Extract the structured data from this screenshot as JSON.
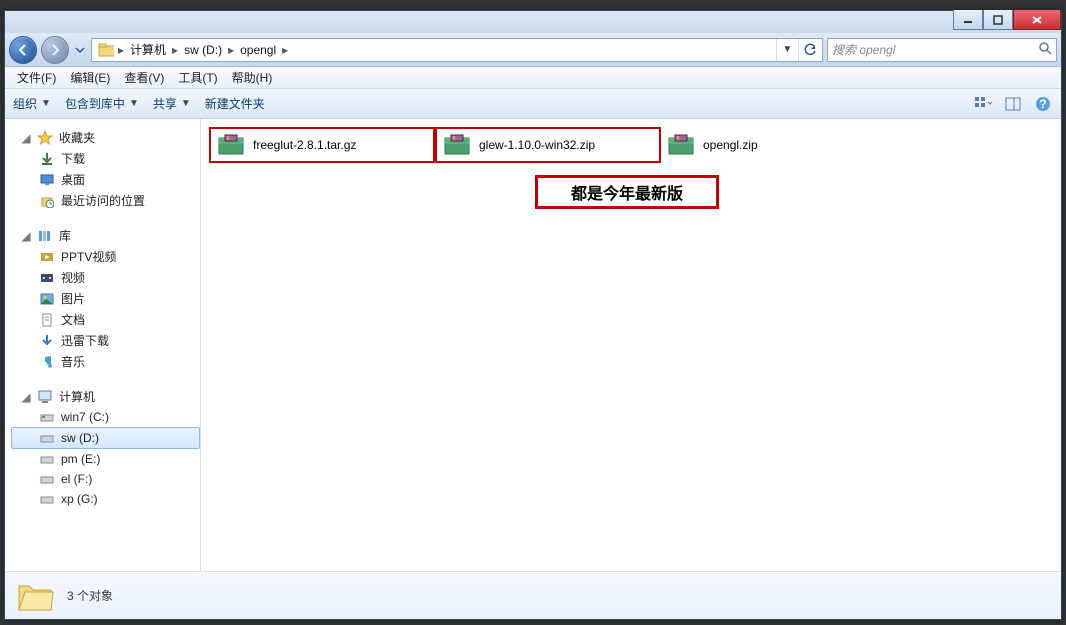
{
  "breadcrumb": {
    "root": "计算机",
    "drive": "sw (D:)",
    "folder": "opengl"
  },
  "search": {
    "placeholder": "搜索 opengl"
  },
  "menu": {
    "file": "文件(F)",
    "edit": "编辑(E)",
    "view": "查看(V)",
    "tools": "工具(T)",
    "help": "帮助(H)"
  },
  "toolbar": {
    "organize": "组织",
    "include": "包含到库中",
    "share": "共享",
    "newfolder": "新建文件夹"
  },
  "sidebar": {
    "favorites": {
      "label": "收藏夹",
      "items": [
        "下载",
        "桌面",
        "最近访问的位置"
      ]
    },
    "libraries": {
      "label": "库",
      "items": [
        "PPTV视频",
        "视频",
        "图片",
        "文档",
        "迅雷下载",
        "音乐"
      ]
    },
    "computer": {
      "label": "计算机",
      "items": [
        "win7 (C:)",
        "sw (D:)",
        "pm (E:)",
        "el (F:)",
        "xp (G:)"
      ]
    }
  },
  "files": [
    {
      "name": "freeglut-2.8.1.tar.gz",
      "boxed": true
    },
    {
      "name": "glew-1.10.0-win32.zip",
      "boxed": true
    },
    {
      "name": "opengl.zip",
      "boxed": false
    }
  ],
  "annotation": "都是今年最新版",
  "details": {
    "count": "3 个对象"
  }
}
